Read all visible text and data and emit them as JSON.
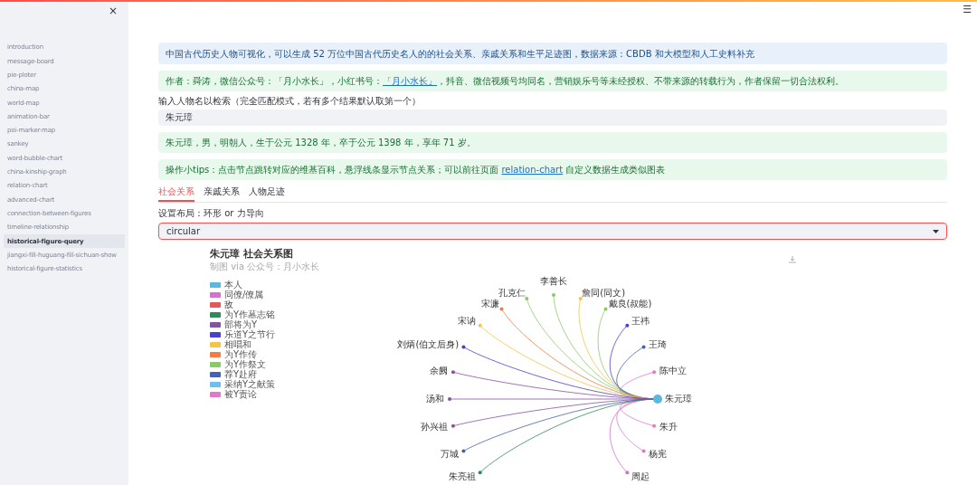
{
  "sidebar": {
    "close": "×",
    "items": [
      {
        "label": "introduction",
        "selected": false
      },
      {
        "label": "message-board",
        "selected": false
      },
      {
        "label": "pie-ploter",
        "selected": false
      },
      {
        "label": "china-map",
        "selected": false
      },
      {
        "label": "world-map",
        "selected": false
      },
      {
        "label": "animation-bar",
        "selected": false
      },
      {
        "label": "poi-marker-map",
        "selected": false
      },
      {
        "label": "sankey",
        "selected": false
      },
      {
        "label": "word-bubble-chart",
        "selected": false
      },
      {
        "label": "china-kinship-graph",
        "selected": false
      },
      {
        "label": "relation-chart",
        "selected": false
      },
      {
        "label": "advanced-chart",
        "selected": false
      },
      {
        "label": "connection-between-figures",
        "selected": false
      },
      {
        "label": "timeline-relationship",
        "selected": false
      },
      {
        "label": "historical-figure-query",
        "selected": true
      },
      {
        "label": "jiangxi-fill-huguang-fill-sichuan-show",
        "selected": false
      },
      {
        "label": "historical-figure-statistics",
        "selected": false
      }
    ]
  },
  "menu": "☰",
  "info_box": "中国古代历史人物可视化，可以生成 52 万位中国古代历史名人的的社会关系、亲戚关系和生平足迹图，数据来源：CBDB 和大模型和人工史料补充",
  "author_box": {
    "before": "作者：舜涛，微信公众号：「月小水长」，小红书号：",
    "link": "「月小水长」",
    "after": "，抖音、微信视频号均同名，营销娱乐号等未经授权、不带来源的转载行为，作者保留一切合法权利。"
  },
  "search": {
    "label": "输入人物名以检索（完全匹配模式，若有多个结果默认取第一个）",
    "value": "朱元璋"
  },
  "result_box": "朱元璋，男，明朝人，生于公元 1328 年，卒于公元 1398 年，享年 71 岁。",
  "tips_box": {
    "before": "操作小tips：点击节点跳转对应的维基百科，悬浮线条显示节点关系；可以前往页面 ",
    "link": "relation-chart",
    "after": " 自定义数据生成类似图表"
  },
  "tabs": [
    {
      "label": "社会关系",
      "selected": true
    },
    {
      "label": "亲戚关系",
      "selected": false
    },
    {
      "label": "人物足迹",
      "selected": false
    }
  ],
  "layout_select": {
    "label": "设置布局：环形 or 力导向",
    "value": "circular"
  },
  "graph": {
    "title": "朱元璋 社会关系图",
    "subtitle": "制图 via 公众号：月小水长",
    "legend": [
      {
        "label": "本人",
        "color": "#5bb8dc"
      },
      {
        "label": "同僚/僚属",
        "color": "#d56fd0"
      },
      {
        "label": "敌",
        "color": "#e05a5a"
      },
      {
        "label": "为Y作墓志铭",
        "color": "#2e8b57"
      },
      {
        "label": "部将为Y",
        "color": "#8552a1"
      },
      {
        "label": "乐道Y之节行",
        "color": "#4b3fcf"
      },
      {
        "label": "相唱和",
        "color": "#f3c34b"
      },
      {
        "label": "为Y作传",
        "color": "#f47b43"
      },
      {
        "label": "为Y作祭文",
        "color": "#8bc96a"
      },
      {
        "label": "荐Y赴府",
        "color": "#4860b0"
      },
      {
        "label": "采纳Y之献策",
        "color": "#6ec0e8"
      },
      {
        "label": "被Y责论",
        "color": "#e07ac8"
      }
    ],
    "center": {
      "label": "朱元璋",
      "color": "#5bb8dc"
    },
    "right_nodes": [
      {
        "label": "李善长",
        "color": "#8bc96a"
      },
      {
        "label": "詹同(同文)",
        "color": "#f3c34b"
      },
      {
        "label": "戴良(叔能)",
        "color": "#8bc96a"
      },
      {
        "label": "王祎",
        "color": "#4b3fcf"
      },
      {
        "label": "王琦",
        "color": "#4860b0"
      },
      {
        "label": "陈中立",
        "color": "#e07ac8"
      },
      {
        "label": "朱升",
        "color": "#e07ac8"
      },
      {
        "label": "杨宪",
        "color": "#e07ac8"
      },
      {
        "label": "周起",
        "color": "#d56fd0"
      }
    ],
    "left_nodes": [
      {
        "label": "孔克仁",
        "color": "#8bc96a"
      },
      {
        "label": "宋濂",
        "color": "#f47b43"
      },
      {
        "label": "宋讷",
        "color": "#f3c34b"
      },
      {
        "label": "刘炳(伯文后身)",
        "color": "#4b3fcf"
      },
      {
        "label": "余阙",
        "color": "#8552a1"
      },
      {
        "label": "汤和",
        "color": "#8552a1"
      },
      {
        "label": "孙兴祖",
        "color": "#8552a1"
      },
      {
        "label": "万城",
        "color": "#4860b0"
      },
      {
        "label": "朱亮祖",
        "color": "#2e8b57"
      }
    ]
  }
}
